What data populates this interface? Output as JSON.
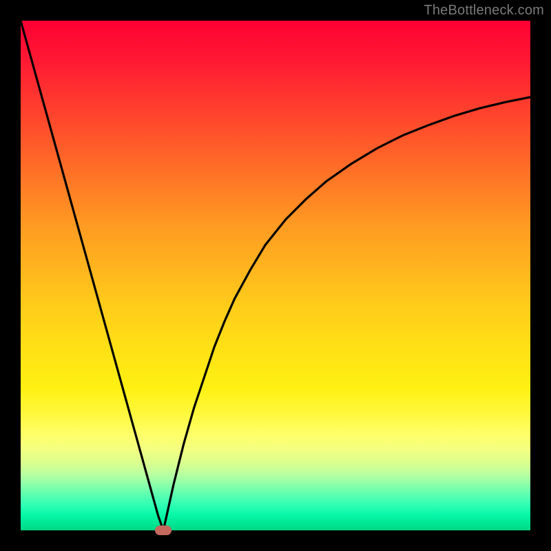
{
  "watermark": "TheBottleneck.com",
  "colors": {
    "frame": "#000000",
    "curve": "#000000",
    "marker": "#c3695e"
  },
  "chart_data": {
    "type": "line",
    "title": "",
    "xlabel": "",
    "ylabel": "",
    "xlim": [
      0,
      100
    ],
    "ylim": [
      0,
      100
    ],
    "grid": false,
    "series": [
      {
        "name": "left-branch",
        "x": [
          0,
          2,
          4,
          6,
          8,
          10,
          12,
          14,
          16,
          18,
          20,
          22,
          24,
          26,
          27,
          28
        ],
        "y": [
          100,
          92.8,
          85.6,
          78.4,
          71.2,
          64.0,
          56.8,
          49.6,
          42.4,
          35.2,
          28.0,
          20.8,
          13.6,
          6.4,
          2.8,
          0
        ]
      },
      {
        "name": "right-branch",
        "x": [
          28,
          30,
          32,
          34,
          36,
          38,
          40,
          42,
          45,
          48,
          52,
          56,
          60,
          65,
          70,
          75,
          80,
          85,
          90,
          95,
          100
        ],
        "y": [
          0,
          9,
          17,
          24,
          30,
          36,
          41,
          45.5,
          51,
          56,
          61,
          65,
          68.5,
          72,
          75,
          77.5,
          79.5,
          81.3,
          82.8,
          84.0,
          85.0
        ]
      }
    ],
    "annotations": [
      {
        "type": "marker",
        "x": 28,
        "y": 0,
        "label": "optimal-point"
      }
    ]
  }
}
